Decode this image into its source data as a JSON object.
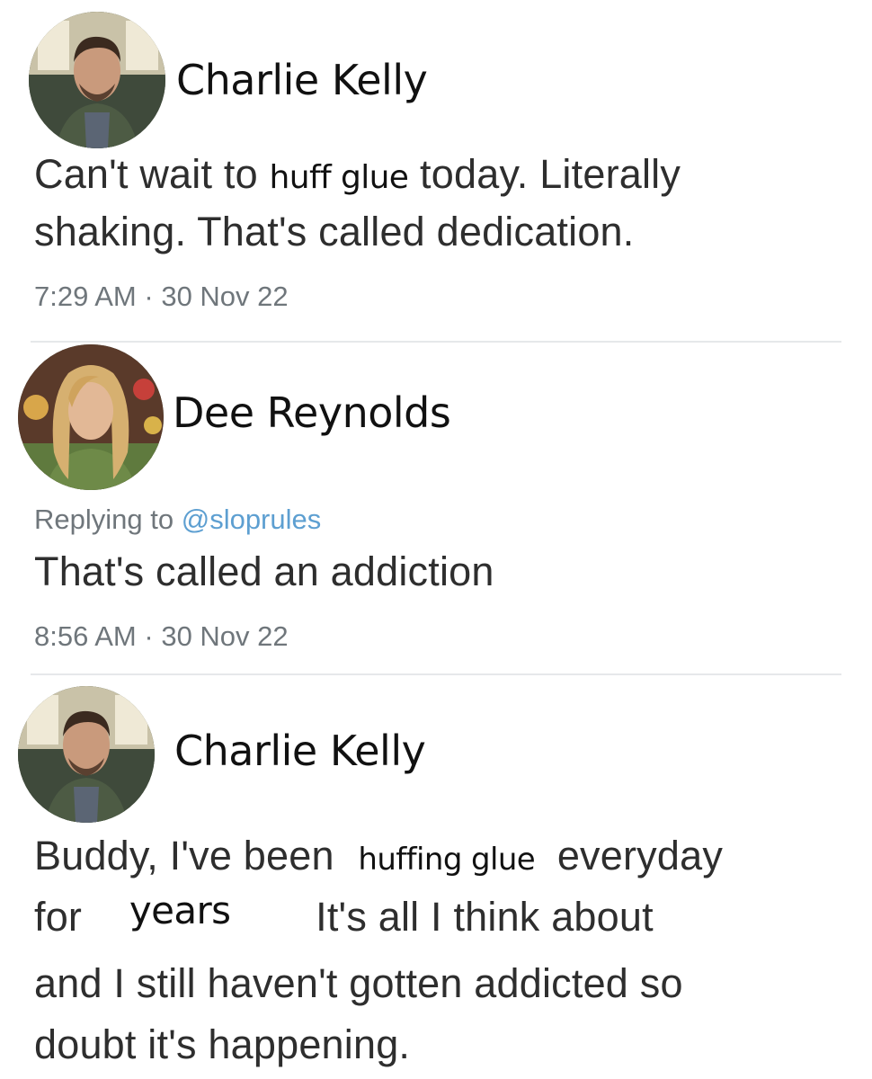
{
  "tweets": [
    {
      "author": "Charlie Kelly",
      "avatar_icon": "charlie-kelly-avatar",
      "lines": [
        {
          "segments": [
            {
              "text": "Can't wait to ",
              "overlay": false
            },
            {
              "text": "huff glue",
              "overlay": true
            },
            {
              "text": " today. Literally",
              "overlay": false
            }
          ]
        },
        {
          "segments": [
            {
              "text": "shaking. That's called dedication.",
              "overlay": false
            }
          ]
        }
      ],
      "time": "7:29 AM",
      "separator": "·",
      "date": "30 Nov 22"
    },
    {
      "author": "Dee Reynolds",
      "avatar_icon": "dee-reynolds-avatar",
      "replying_label": "Replying to",
      "replying_handle": "@sloprules",
      "lines": [
        {
          "segments": [
            {
              "text": "That's called an addiction",
              "overlay": false
            }
          ]
        }
      ],
      "time": "8:56 AM",
      "separator": "·",
      "date": "30 Nov 22"
    },
    {
      "author": "Charlie Kelly",
      "avatar_icon": "charlie-kelly-avatar",
      "lines": [
        {
          "segments": [
            {
              "text": "Buddy, I've been",
              "overlay": false
            },
            {
              "text": "huffing glue",
              "overlay": true
            },
            {
              "text": "everyday",
              "overlay": false
            }
          ]
        },
        {
          "segments": [
            {
              "text": "for",
              "overlay": false
            },
            {
              "text": "years",
              "overlay": true
            },
            {
              "text": "It's all I think about",
              "overlay": false
            }
          ]
        },
        {
          "segments": [
            {
              "text": "and I still haven't gotten addicted so",
              "overlay": false
            }
          ]
        },
        {
          "segments": [
            {
              "text": "doubt it's happening.",
              "overlay": false
            }
          ]
        }
      ]
    }
  ],
  "colors": {
    "handle": "#5d9fd1",
    "meta_gray": "#6f767b",
    "divider": "#e6e8ea"
  }
}
